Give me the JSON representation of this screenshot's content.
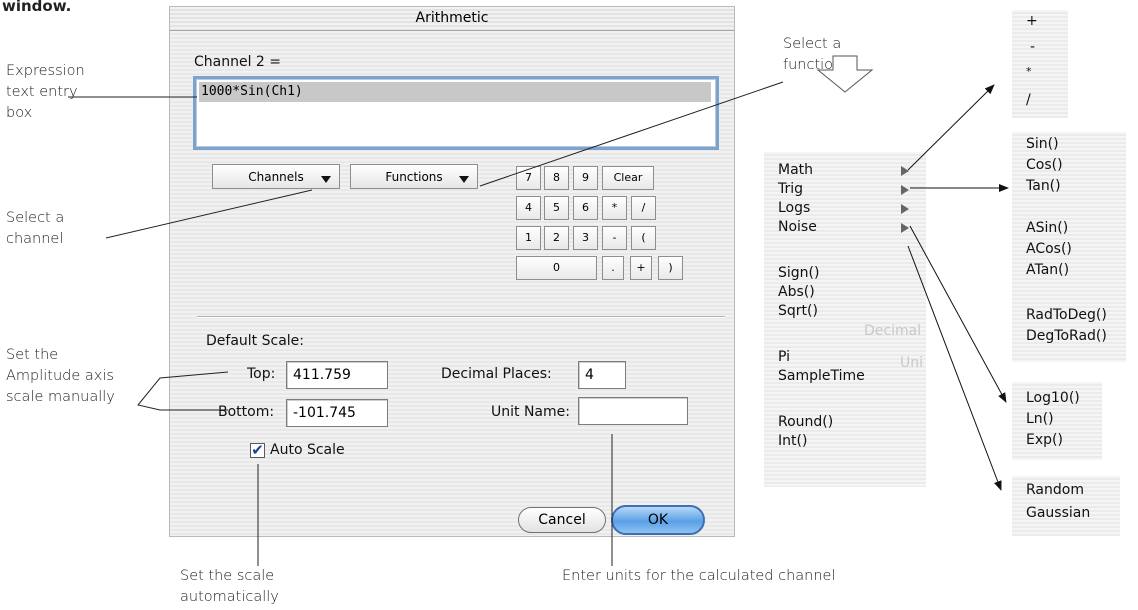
{
  "page_heading": "window.",
  "dialog": {
    "title": "Arithmetic",
    "channel_label": "Channel 2 =",
    "expression_value": "1000*Sin(Ch1)",
    "channels_label": "Channels",
    "functions_label": "Functions",
    "keypad": [
      "7",
      "8",
      "9",
      "Clear",
      "4",
      "5",
      "6",
      "*",
      "/",
      "1",
      "2",
      "3",
      "-",
      "(",
      "0",
      ".",
      "+",
      ")"
    ],
    "default_scale_label": "Default Scale:",
    "top_label": "Top:",
    "top_value": "411.759",
    "bottom_label": "Bottom:",
    "bottom_value": "-101.745",
    "decimal_places_label": "Decimal Places:",
    "decimal_places_value": "4",
    "unit_name_label": "Unit Name:",
    "unit_name_value": "",
    "auto_scale_label": "Auto Scale",
    "auto_scale_checked": true,
    "cancel_label": "Cancel",
    "ok_label": "OK"
  },
  "callouts": {
    "expression_box": [
      "Expression",
      "text entry",
      "box"
    ],
    "select_channel": [
      "Select a",
      "channel"
    ],
    "amplitude": [
      "Set the",
      "Amplitude axis",
      "scale manually"
    ],
    "select_function": [
      "Select a",
      "function"
    ],
    "auto_scale": [
      "Set the scale",
      "automatically"
    ],
    "units": "Enter units for the calculated channel"
  },
  "main_menu": {
    "items": [
      "Math",
      "Trig",
      "Logs",
      "Noise",
      "Sign()",
      "Abs()",
      "Sqrt()",
      "Pi",
      "SampleTime",
      "Round()",
      "Int()"
    ],
    "ghost_text": [
      "Decimal",
      "Uni"
    ]
  },
  "submenus": {
    "math": [
      "+",
      "-",
      "*",
      "/"
    ],
    "trig": [
      "Sin()",
      "Cos()",
      "Tan()",
      "ASin()",
      "ACos()",
      "ATan()",
      "RadToDeg()",
      "DegToRad()"
    ],
    "logs": [
      "Log10()",
      "Ln()",
      "Exp()"
    ],
    "noise": [
      "Random",
      "Gaussian"
    ]
  },
  "colors": {
    "focus_ring": "#7da2ce",
    "ok_button": "#5aa0e6",
    "check": "#1c3f9b"
  }
}
